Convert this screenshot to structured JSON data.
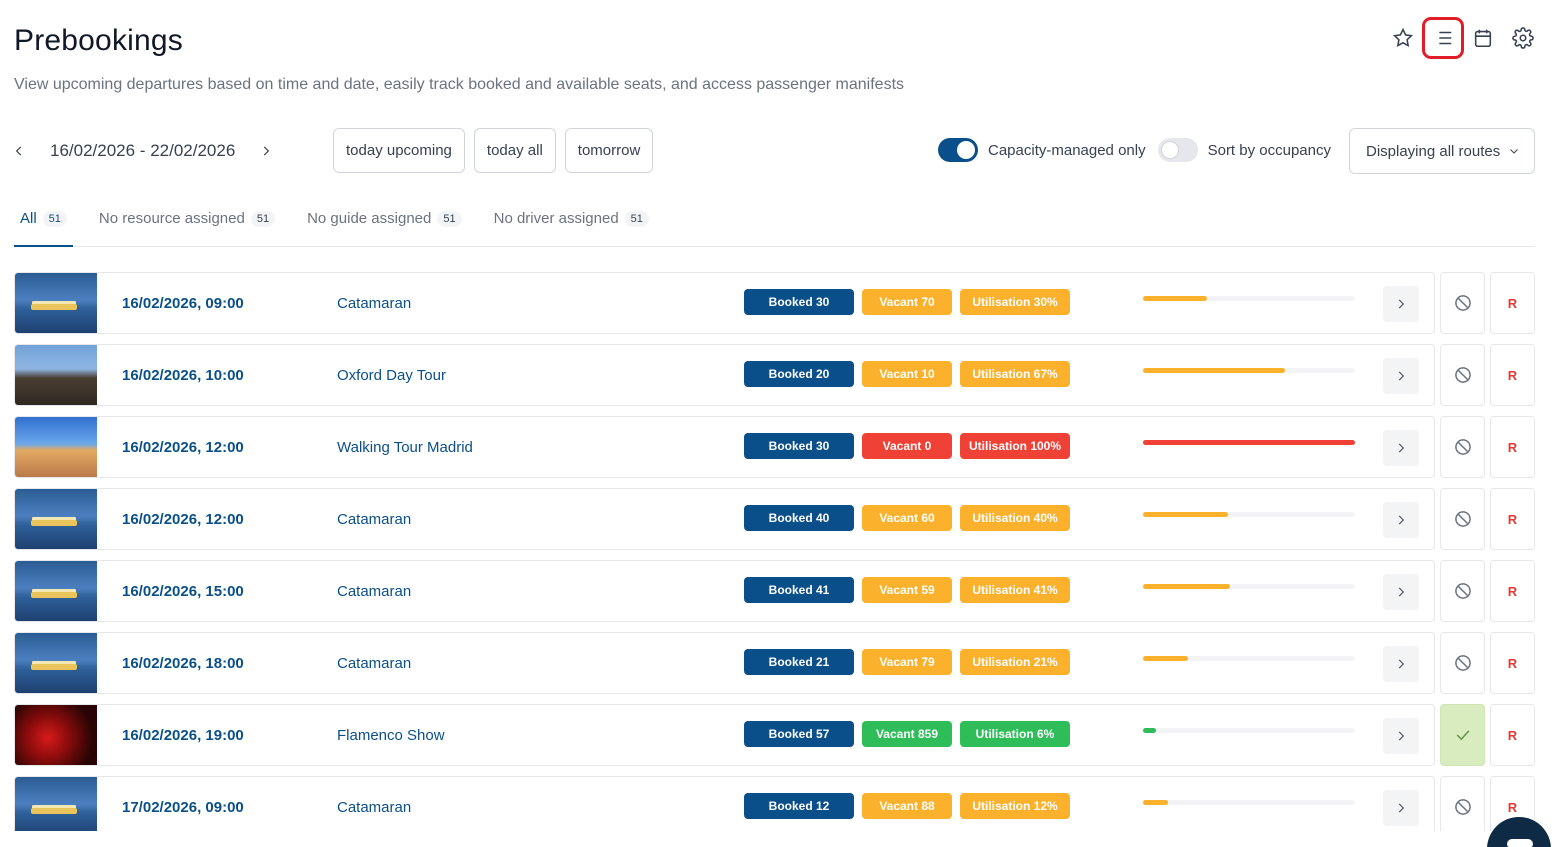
{
  "page": {
    "title": "Prebookings",
    "subtitle": "View upcoming departures based on time and date, easily track booked and available seats, and access passenger manifests"
  },
  "toolbar_icons": [
    "star-icon",
    "list-view-icon",
    "calendar-icon",
    "gear-icon"
  ],
  "date_nav": {
    "range": "16/02/2026 - 22/02/2026",
    "quick_filters": [
      "today upcoming",
      "today all",
      "tomorrow"
    ]
  },
  "filters": {
    "capacity_managed_label": "Capacity-managed only",
    "capacity_managed_on": true,
    "sort_occupancy_label": "Sort by occupancy",
    "sort_occupancy_on": false,
    "route_select": "Displaying all routes"
  },
  "tabs": [
    {
      "label": "All",
      "count": "51"
    },
    {
      "label": "No resource assigned",
      "count": "51"
    },
    {
      "label": "No guide assigned",
      "count": "51"
    },
    {
      "label": "No driver assigned",
      "count": "51"
    }
  ],
  "rows": [
    {
      "datetime": "16/02/2026, 09:00",
      "route": "Catamaran",
      "image": "catamaran",
      "booked": "Booked 30",
      "vacant": "Vacant 70",
      "utilisation": "Utilisation 30%",
      "utilisation_value": 0.3,
      "level": "orange",
      "status": "blocked-icon",
      "r_label": "R"
    },
    {
      "datetime": "16/02/2026, 10:00",
      "route": "Oxford Day Tour",
      "image": "oxford",
      "booked": "Booked 20",
      "vacant": "Vacant 10",
      "utilisation": "Utilisation 67%",
      "utilisation_value": 0.67,
      "level": "orange",
      "status": "blocked-icon",
      "r_label": "R"
    },
    {
      "datetime": "16/02/2026, 12:00",
      "route": "Walking Tour Madrid",
      "image": "madrid",
      "booked": "Booked 30",
      "vacant": "Vacant 0",
      "utilisation": "Utilisation 100%",
      "utilisation_value": 1.0,
      "level": "red",
      "status": "blocked-icon",
      "r_label": "R"
    },
    {
      "datetime": "16/02/2026, 12:00",
      "route": "Catamaran",
      "image": "catamaran",
      "booked": "Booked 40",
      "vacant": "Vacant 60",
      "utilisation": "Utilisation 40%",
      "utilisation_value": 0.4,
      "level": "orange",
      "status": "blocked-icon",
      "r_label": "R"
    },
    {
      "datetime": "16/02/2026, 15:00",
      "route": "Catamaran",
      "image": "catamaran",
      "booked": "Booked 41",
      "vacant": "Vacant 59",
      "utilisation": "Utilisation 41%",
      "utilisation_value": 0.41,
      "level": "orange",
      "status": "blocked-icon",
      "r_label": "R"
    },
    {
      "datetime": "16/02/2026, 18:00",
      "route": "Catamaran",
      "image": "catamaran",
      "booked": "Booked 21",
      "vacant": "Vacant 79",
      "utilisation": "Utilisation 21%",
      "utilisation_value": 0.21,
      "level": "orange",
      "status": "blocked-icon",
      "r_label": "R"
    },
    {
      "datetime": "16/02/2026, 19:00",
      "route": "Flamenco Show",
      "image": "flamenco",
      "booked": "Booked 57",
      "vacant": "Vacant 859",
      "utilisation": "Utilisation 6%",
      "utilisation_value": 0.06,
      "level": "green",
      "status": "check-icon",
      "r_label": "R"
    },
    {
      "datetime": "17/02/2026, 09:00",
      "route": "Catamaran",
      "image": "catamaran",
      "booked": "Booked 12",
      "vacant": "Vacant 88",
      "utilisation": "Utilisation 12%",
      "utilisation_value": 0.12,
      "level": "orange",
      "status": "blocked-icon",
      "r_label": "R"
    }
  ],
  "colors": {
    "primary": "#0b4f8a",
    "orange": "#fbb12c",
    "red": "#ef4136",
    "green": "#2ebd59",
    "active_outline": "#e11d2a"
  }
}
